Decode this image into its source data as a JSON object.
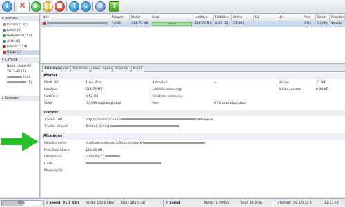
{
  "colors": {
    "accent": "#3d6fb6",
    "error": "#d32c2c",
    "progress": "#9fe29a",
    "arrow": "#27c02a"
  },
  "toolbar": {
    "icons": [
      "add-torrent",
      "remove",
      "start",
      "pause",
      "stop",
      "queue-up",
      "queue-down",
      "settings",
      "help"
    ]
  },
  "sidebar": {
    "state_header": "Státusz",
    "states": [
      {
        "label": "Összes (150)",
        "icon": "all-icon"
      },
      {
        "label": "Letölt (0)",
        "icon": "download-icon"
      },
      {
        "label": "Befejezve (150)",
        "icon": "seeding-icon"
      },
      {
        "label": "Aktív (6)",
        "icon": "active-icon"
      },
      {
        "label": "Inaktív (144)",
        "icon": "inactive-icon"
      },
      {
        "label": "Hibás (1)",
        "icon": "error-icon"
      }
    ],
    "labels_header": "Címkék",
    "labels": [
      {
        "label": "Nincs címke (0)"
      },
      {
        "label": "2013-06 (7)"
      },
      {
        "label": "(43)"
      },
      {
        "label": "(1)"
      }
    ],
    "search_label": "Keresés"
  },
  "list": {
    "columns": [
      "Név",
      "Állapot",
      "Méret",
      "Kész",
      "Letöltve",
      "Feltöltve",
      "Arány",
      "DL",
      "UL",
      "Peer",
      "Seed",
      "Prioritás"
    ],
    "row": {
      "status": "Feltölt",
      "size": "214.75 MB",
      "done": "100%",
      "done_value": 1.0,
      "downloaded": "214.75 MB",
      "uploaded": "6.52 GB",
      "ratio": "31.091",
      "peer": "0 (1)",
      "seed": "0 (499)",
      "priority": "Normál"
    }
  },
  "tabs": [
    "Általános",
    "File",
    "Trackerek",
    "Peer",
    "Speed",
    "Pluginok",
    "Napló"
  ],
  "details": {
    "transfer_header": "Átvitel",
    "elapsed_label": "Eltelt idő:",
    "elapsed_value": "1nap 3óra",
    "remaining_label": "Hátralévő:",
    "remaining_value": "∞",
    "ratio_label": "Arány:",
    "ratio_value": "31.091",
    "downloaded_label": "Letöltve:",
    "downloaded_value": "214.75 MB",
    "dl_speed_label": "Letöltési sebesség:",
    "dl_speed_value": "",
    "wasted_label": "Kárbaveszett:",
    "wasted_value": "0.00 KB",
    "uploaded_label": "Feltöltve:",
    "uploaded_value": "6.52 GB",
    "ul_speed_label": "Feltöltési sebesség:",
    "ul_speed_value": "",
    "seeds_label": "Seed:",
    "seeds_value": "0 / 499 csatlakoztatott",
    "peers_label": "Peer:",
    "peers_value": "0 / 1 csatlakoztatott",
    "tracker_header": "Tracker",
    "tracker_url_label": "Tracker URL:",
    "tracker_url_prefix": "http://c.ncore.cc:2710/",
    "tracker_url_suffix": "/announce",
    "tracker_status_label": "Tracker állapot:",
    "tracker_status_prefix": "Tracker: [Error]",
    "general_header": "Általános",
    "save_path_label": "Mentési helye:",
    "save_path_value": "/nas/users/intruder3r5/torrent/work/",
    "free_space_label": "Free Disk Space:",
    "free_space_value": "124.48 GB",
    "created_label": "Létrehozva:",
    "created_value": "2009-03-22",
    "hash_label": "Hash:",
    "comment_label": "Megjegyzés:"
  },
  "status": {
    "progress": "56%",
    "progress_value": 0.56,
    "dl_speed": "Speed: 91.7 KB/s",
    "dl_limit": "Korlát: 100.0 KB/s",
    "dl_total": "Total: 285.5 GB",
    "ul_speed": "Speed:",
    "ul_limit": "Korlát: 1.0 MB/s",
    "ul_total": "Total: 80.8 GB",
    "app": "rTorrent: 0.8.6/0.12.6",
    "time": "13:27:28"
  }
}
